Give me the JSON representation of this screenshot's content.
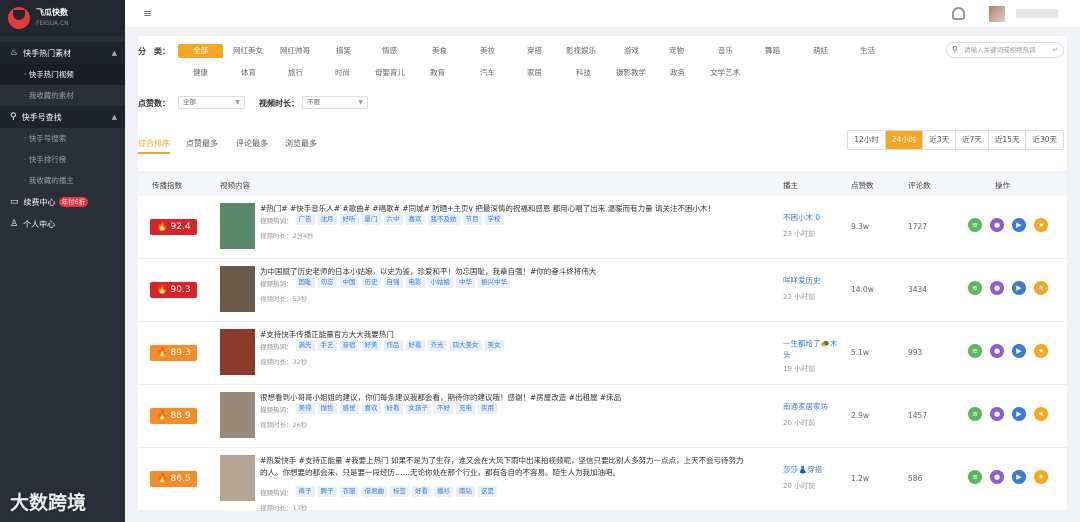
{
  "brand": {
    "name": "飞瓜快数",
    "domain": "FEIGUA.CN"
  },
  "sidebar": {
    "groups": [
      {
        "label": "快手热门素材",
        "icon": "fire-icon",
        "items": [
          "· 快手热门视频",
          "· 我收藏的素材"
        ]
      },
      {
        "label": "快手号查找",
        "icon": "search-icon",
        "items": [
          "· 快手号搜索",
          "· 快手排行榜",
          "· 我收藏的播主"
        ]
      }
    ],
    "buy": {
      "label": "续费中心",
      "badge": "年付6折"
    },
    "profile": "个人中心"
  },
  "filter": {
    "category_label": "分　类：",
    "categories_row1": [
      "全部",
      "网红美女",
      "网红帅哥",
      "搞笑",
      "情感",
      "美食",
      "美妆",
      "穿搭",
      "影视娱乐",
      "游戏",
      "宠物",
      "音乐",
      "舞蹈",
      "萌娃",
      "生活"
    ],
    "categories_row2": [
      "健康",
      "体育",
      "旅行",
      "时尚",
      "母婴育儿",
      "教育",
      "汽车",
      "家居",
      "科技",
      "摄影教学",
      "政务",
      "文学艺术"
    ],
    "likes_label": "点赞数：",
    "likes_value": "全部",
    "duration_label": "视频时长：",
    "duration_value": "不限",
    "search_placeholder": "请输入关键词或视频热词",
    "tabs": [
      "综合排序",
      "点赞最多",
      "评论最多",
      "浏览最多"
    ],
    "ranges": [
      "12小时",
      "24小时",
      "近3天",
      "近7天",
      "近15天",
      "近30天"
    ],
    "active_range": "24小时"
  },
  "table": {
    "headers": {
      "index": "传播指数",
      "content": "视频内容",
      "anchor": "播主",
      "likes": "点赞数",
      "comments": "评论数",
      "ops": "操作"
    },
    "hot_label": "视频热词：",
    "rows": [
      {
        "score": "🔥 92.4",
        "score_color": "#d9232a",
        "title": "#热门# #快手音乐人# #歌曲# #唱歌# #同城# 防晒+主页v 把最深情的祝福和感恩 都用心唱了出来 温暖而有力量 请关注不困小木！",
        "tags": [
          "广告",
          "沈月",
          "好听",
          "厦门",
          "六中",
          "喜欢",
          "我不及妨",
          "节目",
          "学校"
        ],
        "duration": "视频时长：2分4秒",
        "anchor": "不困小木 0",
        "time": "23 小时前",
        "likes": "9.3w",
        "comments": "1727",
        "thumb": "#5a8a6a"
      },
      {
        "score": "🔥 90.3",
        "score_color": "#d9232a",
        "title": "为中国赋了历史老师的日本小姑娘，以史为鉴，珍爱和平！勿忘国耻，我辈自强！#你的奋斗终将伟大",
        "tags": [
          "国耻",
          "勿忘",
          "中国",
          "历史",
          "自强",
          "电影",
          "小姑娘",
          "中华",
          "振兴中华"
        ],
        "duration": "视频时长：53秒",
        "anchor": "咩咩爱历史",
        "time": "22 小时前",
        "likes": "14.0w",
        "comments": "3434",
        "thumb": "#6b5a4a"
      },
      {
        "score": "🔥 89.3",
        "score_color": "#f58c2a",
        "title": "#支持快手传播正能量官方大大我要热门",
        "tags": [
          "满先",
          "手艺",
          "音宿",
          "好美",
          "作品",
          "好看",
          "齐光",
          "四大美女",
          "美女"
        ],
        "duration": "视频时长：32秒",
        "anchor": "一生都给了🐢木头",
        "time": "19 小时前",
        "likes": "5.1w",
        "comments": "993",
        "thumb": "#8a3a2a"
      },
      {
        "score": "🔥 88.9",
        "score_color": "#f58c2a",
        "title": "很想看到小哥哥小姐姐的建议，你们每条建议我都会看，期待你的建议哦！感谢！#房屋改造 #出租屋 #床品",
        "tags": [
          "美得",
          "抛哲",
          "感觉",
          "喜欢",
          "好看",
          "女孩子",
          "不好",
          "充电",
          "实用"
        ],
        "duration": "视频时长：26秒",
        "anchor": "南通家居家坊",
        "time": "20 小时前",
        "likes": "2.9w",
        "comments": "1457",
        "thumb": "#9a8a7a"
      },
      {
        "score": "🔥 86.5",
        "score_color": "#f58c2a",
        "title": "#热爱快手 #支持正能量 #我要上热门 如果不是为了生存，谁又会在大风下雨中出来拍视频呢，坚信只要比别人多努力一点点，上天不会亏待努力的人。你想要的都会来，只是要一段经历……无论你处在那个行业，都有各自的不容易。陌生人为我加油吧。",
        "tags": [
          "裤子",
          "脾子",
          "衣服",
          "借君曲",
          "标签",
          "好看",
          "播衫",
          "南钻",
          "这是"
        ],
        "duration": "视频时长：13秒",
        "anchor": "莎莎👗穿搭",
        "time": "20 小时前",
        "likes": "1.2w",
        "comments": "586",
        "thumb": "#b5a595"
      }
    ]
  },
  "watermark": "大数跨境"
}
